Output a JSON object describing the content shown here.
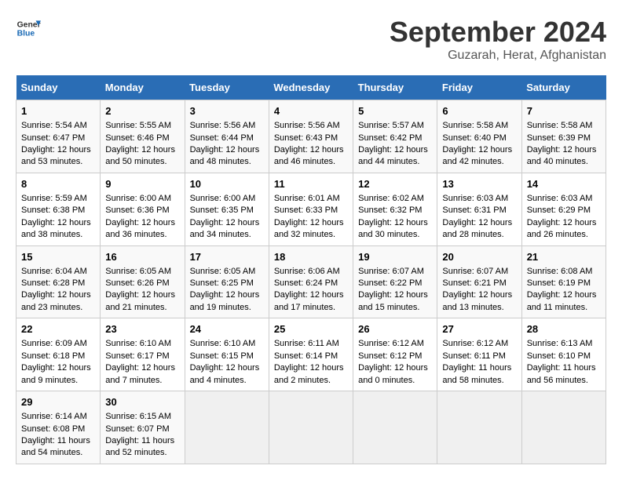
{
  "logo": {
    "line1": "General",
    "line2": "Blue"
  },
  "title": "September 2024",
  "subtitle": "Guzarah, Herat, Afghanistan",
  "days_of_week": [
    "Sunday",
    "Monday",
    "Tuesday",
    "Wednesday",
    "Thursday",
    "Friday",
    "Saturday"
  ],
  "weeks": [
    [
      {
        "day": "1",
        "sunrise": "Sunrise: 5:54 AM",
        "sunset": "Sunset: 6:47 PM",
        "daylight": "Daylight: 12 hours",
        "daylight2": "and 53 minutes."
      },
      {
        "day": "2",
        "sunrise": "Sunrise: 5:55 AM",
        "sunset": "Sunset: 6:46 PM",
        "daylight": "Daylight: 12 hours",
        "daylight2": "and 50 minutes."
      },
      {
        "day": "3",
        "sunrise": "Sunrise: 5:56 AM",
        "sunset": "Sunset: 6:44 PM",
        "daylight": "Daylight: 12 hours",
        "daylight2": "and 48 minutes."
      },
      {
        "day": "4",
        "sunrise": "Sunrise: 5:56 AM",
        "sunset": "Sunset: 6:43 PM",
        "daylight": "Daylight: 12 hours",
        "daylight2": "and 46 minutes."
      },
      {
        "day": "5",
        "sunrise": "Sunrise: 5:57 AM",
        "sunset": "Sunset: 6:42 PM",
        "daylight": "Daylight: 12 hours",
        "daylight2": "and 44 minutes."
      },
      {
        "day": "6",
        "sunrise": "Sunrise: 5:58 AM",
        "sunset": "Sunset: 6:40 PM",
        "daylight": "Daylight: 12 hours",
        "daylight2": "and 42 minutes."
      },
      {
        "day": "7",
        "sunrise": "Sunrise: 5:58 AM",
        "sunset": "Sunset: 6:39 PM",
        "daylight": "Daylight: 12 hours",
        "daylight2": "and 40 minutes."
      }
    ],
    [
      {
        "day": "8",
        "sunrise": "Sunrise: 5:59 AM",
        "sunset": "Sunset: 6:38 PM",
        "daylight": "Daylight: 12 hours",
        "daylight2": "and 38 minutes."
      },
      {
        "day": "9",
        "sunrise": "Sunrise: 6:00 AM",
        "sunset": "Sunset: 6:36 PM",
        "daylight": "Daylight: 12 hours",
        "daylight2": "and 36 minutes."
      },
      {
        "day": "10",
        "sunrise": "Sunrise: 6:00 AM",
        "sunset": "Sunset: 6:35 PM",
        "daylight": "Daylight: 12 hours",
        "daylight2": "and 34 minutes."
      },
      {
        "day": "11",
        "sunrise": "Sunrise: 6:01 AM",
        "sunset": "Sunset: 6:33 PM",
        "daylight": "Daylight: 12 hours",
        "daylight2": "and 32 minutes."
      },
      {
        "day": "12",
        "sunrise": "Sunrise: 6:02 AM",
        "sunset": "Sunset: 6:32 PM",
        "daylight": "Daylight: 12 hours",
        "daylight2": "and 30 minutes."
      },
      {
        "day": "13",
        "sunrise": "Sunrise: 6:03 AM",
        "sunset": "Sunset: 6:31 PM",
        "daylight": "Daylight: 12 hours",
        "daylight2": "and 28 minutes."
      },
      {
        "day": "14",
        "sunrise": "Sunrise: 6:03 AM",
        "sunset": "Sunset: 6:29 PM",
        "daylight": "Daylight: 12 hours",
        "daylight2": "and 26 minutes."
      }
    ],
    [
      {
        "day": "15",
        "sunrise": "Sunrise: 6:04 AM",
        "sunset": "Sunset: 6:28 PM",
        "daylight": "Daylight: 12 hours",
        "daylight2": "and 23 minutes."
      },
      {
        "day": "16",
        "sunrise": "Sunrise: 6:05 AM",
        "sunset": "Sunset: 6:26 PM",
        "daylight": "Daylight: 12 hours",
        "daylight2": "and 21 minutes."
      },
      {
        "day": "17",
        "sunrise": "Sunrise: 6:05 AM",
        "sunset": "Sunset: 6:25 PM",
        "daylight": "Daylight: 12 hours",
        "daylight2": "and 19 minutes."
      },
      {
        "day": "18",
        "sunrise": "Sunrise: 6:06 AM",
        "sunset": "Sunset: 6:24 PM",
        "daylight": "Daylight: 12 hours",
        "daylight2": "and 17 minutes."
      },
      {
        "day": "19",
        "sunrise": "Sunrise: 6:07 AM",
        "sunset": "Sunset: 6:22 PM",
        "daylight": "Daylight: 12 hours",
        "daylight2": "and 15 minutes."
      },
      {
        "day": "20",
        "sunrise": "Sunrise: 6:07 AM",
        "sunset": "Sunset: 6:21 PM",
        "daylight": "Daylight: 12 hours",
        "daylight2": "and 13 minutes."
      },
      {
        "day": "21",
        "sunrise": "Sunrise: 6:08 AM",
        "sunset": "Sunset: 6:19 PM",
        "daylight": "Daylight: 12 hours",
        "daylight2": "and 11 minutes."
      }
    ],
    [
      {
        "day": "22",
        "sunrise": "Sunrise: 6:09 AM",
        "sunset": "Sunset: 6:18 PM",
        "daylight": "Daylight: 12 hours",
        "daylight2": "and 9 minutes."
      },
      {
        "day": "23",
        "sunrise": "Sunrise: 6:10 AM",
        "sunset": "Sunset: 6:17 PM",
        "daylight": "Daylight: 12 hours",
        "daylight2": "and 7 minutes."
      },
      {
        "day": "24",
        "sunrise": "Sunrise: 6:10 AM",
        "sunset": "Sunset: 6:15 PM",
        "daylight": "Daylight: 12 hours",
        "daylight2": "and 4 minutes."
      },
      {
        "day": "25",
        "sunrise": "Sunrise: 6:11 AM",
        "sunset": "Sunset: 6:14 PM",
        "daylight": "Daylight: 12 hours",
        "daylight2": "and 2 minutes."
      },
      {
        "day": "26",
        "sunrise": "Sunrise: 6:12 AM",
        "sunset": "Sunset: 6:12 PM",
        "daylight": "Daylight: 12 hours",
        "daylight2": "and 0 minutes."
      },
      {
        "day": "27",
        "sunrise": "Sunrise: 6:12 AM",
        "sunset": "Sunset: 6:11 PM",
        "daylight": "Daylight: 11 hours",
        "daylight2": "and 58 minutes."
      },
      {
        "day": "28",
        "sunrise": "Sunrise: 6:13 AM",
        "sunset": "Sunset: 6:10 PM",
        "daylight": "Daylight: 11 hours",
        "daylight2": "and 56 minutes."
      }
    ],
    [
      {
        "day": "29",
        "sunrise": "Sunrise: 6:14 AM",
        "sunset": "Sunset: 6:08 PM",
        "daylight": "Daylight: 11 hours",
        "daylight2": "and 54 minutes."
      },
      {
        "day": "30",
        "sunrise": "Sunrise: 6:15 AM",
        "sunset": "Sunset: 6:07 PM",
        "daylight": "Daylight: 11 hours",
        "daylight2": "and 52 minutes."
      },
      null,
      null,
      null,
      null,
      null
    ]
  ]
}
